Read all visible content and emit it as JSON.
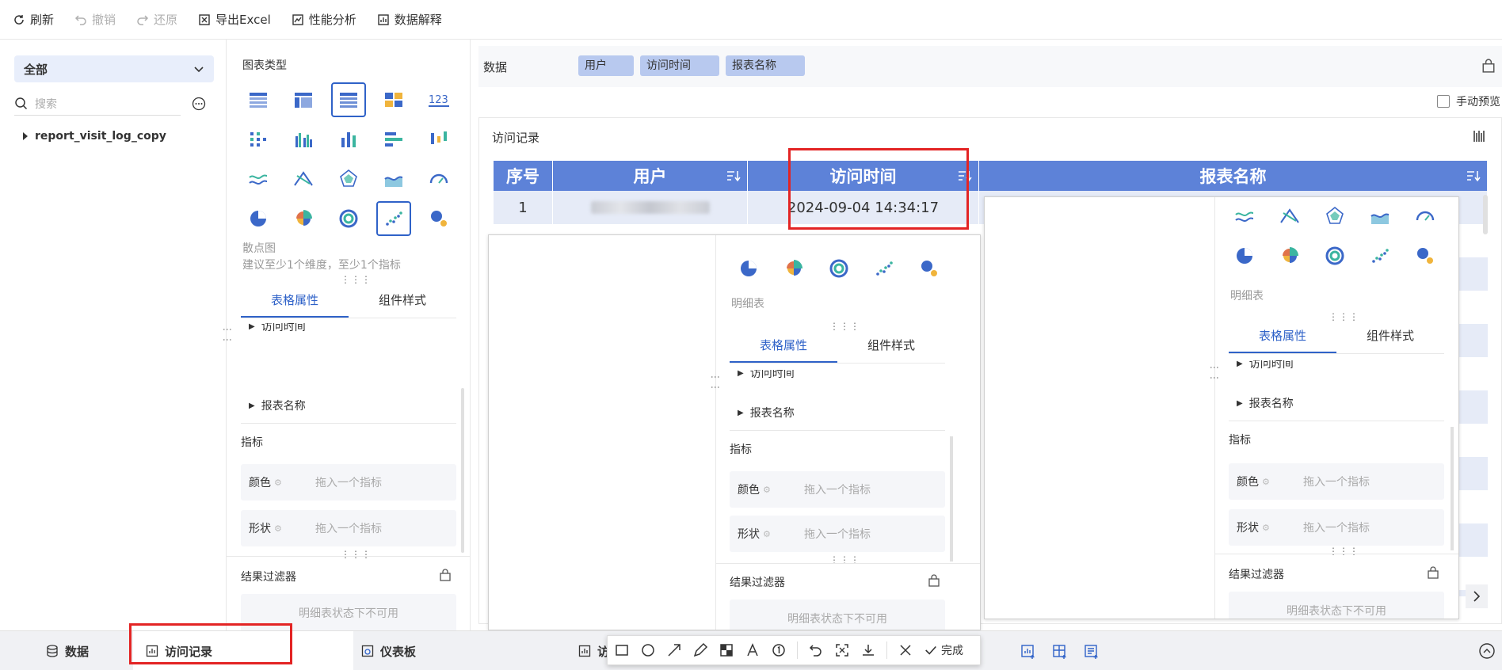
{
  "toolbar": {
    "refresh": "刷新",
    "undo": "撤销",
    "redo": "还原",
    "export": "导出Excel",
    "perf": "性能分析",
    "explain": "数据解释"
  },
  "left": {
    "dropdown": "全部",
    "search_placeholder": "搜索",
    "tree_item": "report_visit_log_copy"
  },
  "chart_panel": {
    "title": "图表类型",
    "selected_name": "散点图",
    "hint": "建议至少1个维度，至少1个指标",
    "selected_name_alt": "明细表",
    "tabs": [
      "表格属性",
      "组件样式"
    ],
    "field_cut": "访问时间",
    "field_report": "报表名称",
    "metric_title": "指标",
    "color_label": "颜色",
    "shape_label": "形状",
    "drop_placeholder": "拖入一个指标",
    "filter_title": "结果过滤器",
    "filter_disabled": "明细表状态下不可用"
  },
  "data_row": {
    "label": "数据",
    "pills": [
      "用户",
      "访问时间",
      "报表名称"
    ],
    "manual_preview": "手动预览"
  },
  "report": {
    "title": "访问记录",
    "headers": [
      "序号",
      "用户",
      "访问时间",
      "报表名称"
    ],
    "row1": {
      "index": "1",
      "time": "2024-09-04 14:34:17"
    }
  },
  "bottom": {
    "tab_data": "数据",
    "tab_visit": "访问记录",
    "tab_dashboard": "仪表板",
    "tab_partial": "访",
    "done": "完成"
  },
  "colors": {
    "accent": "#2f62c8",
    "header_bg": "#5d82d8",
    "highlight": "#e32424"
  }
}
